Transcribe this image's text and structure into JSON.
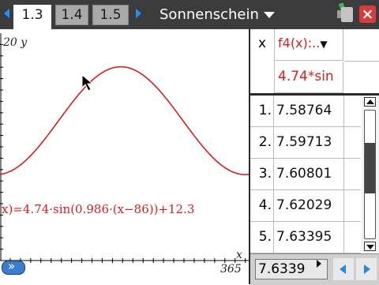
{
  "tabs": [
    {
      "label": "1.3",
      "active": true
    },
    {
      "label": "1.4",
      "active": false
    },
    {
      "label": "1.5",
      "active": false
    }
  ],
  "document_title": "Sonnenschein",
  "graph": {
    "ymax_label": "20 y",
    "xmax_label": "365",
    "x_axis_label": "x",
    "function_label": "x)=4.74·sin(0.986·(x−86))+12.3",
    "curve_color": "#d21f1f",
    "window": {
      "xmin": 0,
      "xmax": 365,
      "ymin": 0,
      "ymax": 20
    },
    "function": {
      "a": 4.74,
      "b": 0.986,
      "c": 86,
      "d": 12.3
    }
  },
  "table": {
    "x_header": "x",
    "func_header": "f4(x):..",
    "func_expression": "4.74*sin",
    "rows": [
      {
        "index": "1.",
        "value": "7.58764"
      },
      {
        "index": "2.",
        "value": "7.59713"
      },
      {
        "index": "3.",
        "value": "7.60801"
      },
      {
        "index": "4.",
        "value": "7.62029"
      },
      {
        "index": "5.",
        "value": "7.63395"
      }
    ],
    "entry_value": "7.6339",
    "scroll_position": 0.25
  }
}
